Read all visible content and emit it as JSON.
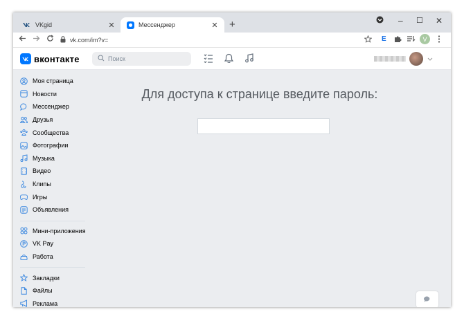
{
  "browser": {
    "tabs": [
      {
        "title": "VKgid",
        "close": "✕"
      },
      {
        "title": "Мессенджер",
        "close": "✕"
      }
    ],
    "new_tab": "+",
    "window_controls": {
      "minimize": "–",
      "maximize": "☐",
      "close": "✕"
    },
    "url": "vk.com/im?v=",
    "ext_e": "E",
    "profile_letter": "V"
  },
  "vk": {
    "logo_text": "вконтакте",
    "search_placeholder": "Поиск"
  },
  "sidebar": {
    "group1": [
      {
        "label": "Моя страница",
        "icon": "user-circle-icon"
      },
      {
        "label": "Новости",
        "icon": "news-icon"
      },
      {
        "label": "Мессенджер",
        "icon": "message-icon"
      },
      {
        "label": "Друзья",
        "icon": "friends-icon"
      },
      {
        "label": "Сообщества",
        "icon": "communities-icon"
      },
      {
        "label": "Фотографии",
        "icon": "photo-icon"
      },
      {
        "label": "Музыка",
        "icon": "music-icon"
      },
      {
        "label": "Видео",
        "icon": "video-icon"
      },
      {
        "label": "Клипы",
        "icon": "clips-icon"
      },
      {
        "label": "Игры",
        "icon": "gamepad-icon"
      },
      {
        "label": "Объявления",
        "icon": "ads-icon"
      }
    ],
    "group2": [
      {
        "label": "Мини-приложения",
        "icon": "apps-icon"
      },
      {
        "label": "VK Pay",
        "icon": "vkpay-icon"
      },
      {
        "label": "Работа",
        "icon": "briefcase-icon"
      }
    ],
    "group3": [
      {
        "label": "Закладки",
        "icon": "star-icon"
      },
      {
        "label": "Файлы",
        "icon": "file-icon"
      },
      {
        "label": "Реклама",
        "icon": "megaphone-icon"
      }
    ]
  },
  "main": {
    "title": "Для доступа к странице введите пароль:",
    "password_value": ""
  },
  "colors": {
    "accent": "#0077ff",
    "background": "#ebedf0"
  }
}
